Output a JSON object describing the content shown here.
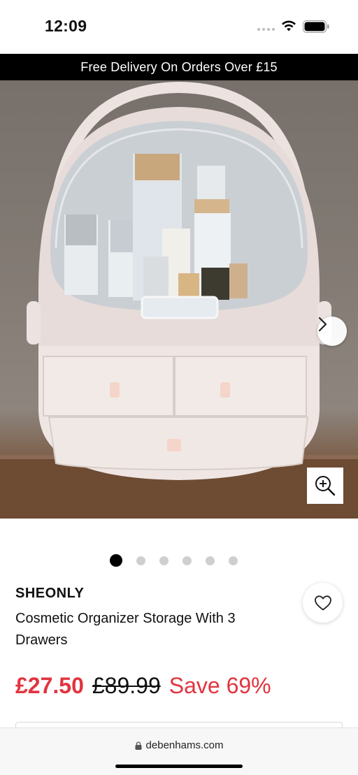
{
  "status_bar": {
    "time": "12:09"
  },
  "promo": {
    "text": "Free Delivery On Orders Over £15"
  },
  "gallery": {
    "image_count": 6,
    "active_index": 0
  },
  "product": {
    "brand": "SHEONLY",
    "title": "Cosmetic Organizer Storage With 3 Drawers",
    "price_current": "£27.50",
    "price_original": "£89.99",
    "save_text": "Save 69%"
  },
  "browser": {
    "domain": "debenhams.com"
  },
  "colors": {
    "sale_red": "#e2343f",
    "banner_black": "#000000"
  },
  "icons": [
    "wifi-icon",
    "battery-icon",
    "chevron-right-icon",
    "zoom-in-icon",
    "heart-icon",
    "lock-icon"
  ]
}
